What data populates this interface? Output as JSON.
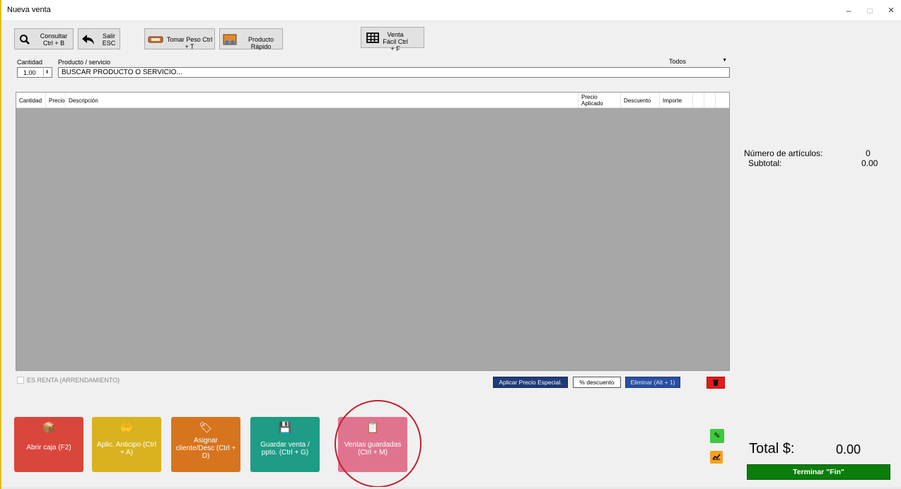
{
  "window": {
    "title": "Nueva venta",
    "minimize": "–",
    "maximize": "□",
    "close": "×"
  },
  "toolbar": {
    "consultar": "Consultar Ctrl + B",
    "salir": "Salir ESC",
    "tomar_peso": "Tomar Peso Ctrl + T",
    "producto_rapido": "Producto Rápido",
    "venta_facil": "Venta Fácil Ctrl + F"
  },
  "entry": {
    "cantidad_label": "Cantidad",
    "producto_label": "Producto / servicio",
    "cantidad_value": "1.00",
    "producto_placeholder": "BUSCAR PRODUCTO O SERVICIO...",
    "filter_value": "Todos"
  },
  "grid": {
    "columns": [
      "Cantidad",
      "Precio",
      "Descripción",
      "Precio Aplicado",
      "Descuento",
      "Importe"
    ],
    "rows": []
  },
  "options": {
    "es_renta": "ES RENTA (ARRENDAMIENTO)"
  },
  "row_actions": {
    "aplicar_precio": "Aplicar Precio Especial.",
    "descuento": "% descuento",
    "eliminar": "Eliminar (Alt + 1)"
  },
  "summary": {
    "num_articulos_label": "Número de artículos:",
    "num_articulos_value": "0",
    "subtotal_label": "Subtotal:",
    "subtotal_value": "0.00"
  },
  "actions": [
    {
      "label": "Abrir caja (F2)",
      "color": "#d9463c",
      "icon": "box-icon"
    },
    {
      "label": "Aplic. Anticipo (Ctrl + A)",
      "color": "#d9b21f",
      "icon": "coin-hand-icon"
    },
    {
      "label": "Asignar cliente/Desc (Ctrl + D)",
      "color": "#d7741e",
      "icon": "tag-icon"
    },
    {
      "label": "Guardar venta / ppto. (Ctrl + G)",
      "color": "#1e9c86",
      "icon": "save-icon"
    },
    {
      "label": "Ventas guardadas (Ctrl + M)",
      "color": "#e0748f",
      "icon": "clipboard-icon"
    }
  ],
  "total": {
    "label": "Total $:",
    "value": "0.00",
    "finish_button": "Terminar \"Fin\""
  }
}
